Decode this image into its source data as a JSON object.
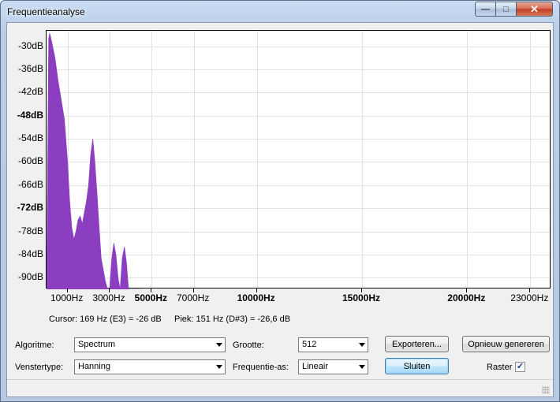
{
  "window": {
    "title": "Frequentieanalyse",
    "minimize_glyph": "—",
    "maximize_glyph": "□",
    "close_glyph": "✕"
  },
  "chart_data": {
    "type": "area",
    "color": "#8b3fc0",
    "title": "",
    "xlabel": "",
    "ylabel": "",
    "xlim": [
      0,
      24000
    ],
    "ylim": [
      -93,
      -26
    ],
    "grid": true,
    "y_ticks": [
      {
        "label": "-30dB",
        "value": -30,
        "bold": false
      },
      {
        "label": "-36dB",
        "value": -36,
        "bold": false
      },
      {
        "label": "-42dB",
        "value": -42,
        "bold": false
      },
      {
        "label": "-48dB",
        "value": -48,
        "bold": true
      },
      {
        "label": "-54dB",
        "value": -54,
        "bold": false
      },
      {
        "label": "-60dB",
        "value": -60,
        "bold": false
      },
      {
        "label": "-66dB",
        "value": -66,
        "bold": false
      },
      {
        "label": "-72dB",
        "value": -72,
        "bold": true
      },
      {
        "label": "-78dB",
        "value": -78,
        "bold": false
      },
      {
        "label": "-84dB",
        "value": -84,
        "bold": false
      },
      {
        "label": "-90dB",
        "value": -90,
        "bold": false
      }
    ],
    "x_ticks": [
      {
        "label": "1000Hz",
        "value": 1000,
        "bold": false
      },
      {
        "label": "3000Hz",
        "value": 3000,
        "bold": false
      },
      {
        "label": "5000Hz",
        "value": 5000,
        "bold": true
      },
      {
        "label": "7000Hz",
        "value": 7000,
        "bold": false
      },
      {
        "label": "10000Hz",
        "value": 10000,
        "bold": true
      },
      {
        "label": "15000Hz",
        "value": 15000,
        "bold": true
      },
      {
        "label": "20000Hz",
        "value": 20000,
        "bold": true
      },
      {
        "label": "23000Hz",
        "value": 23000,
        "bold": false
      }
    ],
    "x": [
      0,
      100,
      151,
      250,
      400,
      550,
      700,
      850,
      1000,
      1100,
      1200,
      1300,
      1400,
      1500,
      1600,
      1700,
      1800,
      1900,
      2000,
      2100,
      2200,
      2300,
      2400,
      2500,
      2600,
      2700,
      2800,
      2900,
      3000,
      3100,
      3200,
      3300,
      3400,
      3500,
      3600,
      3700,
      3800,
      3900,
      4000,
      4100,
      4200,
      4300,
      4400,
      4500
    ],
    "y": [
      -93,
      -28,
      -26.6,
      -29,
      -33,
      -39,
      -44,
      -49,
      -60,
      -70,
      -77,
      -80,
      -78,
      -75,
      -74,
      -76,
      -73,
      -70,
      -66,
      -58,
      -54,
      -60,
      -68,
      -77,
      -85,
      -88,
      -91,
      -93,
      -93,
      -85,
      -81,
      -84,
      -90,
      -93,
      -85,
      -82,
      -86,
      -93,
      -93,
      -93,
      -93,
      -93,
      -93,
      -93
    ]
  },
  "info": {
    "cursor": "Cursor: 169 Hz (E3) = -26 dB",
    "peak": "Piek: 151 Hz (D#3) = -26,6 dB"
  },
  "controls": {
    "algorithm_label": "Algoritme:",
    "algorithm_value": "Spectrum",
    "window_type_label": "Venstertype:",
    "window_type_value": "Hanning",
    "size_label": "Grootte:",
    "size_value": "512",
    "freq_axis_label": "Frequentie-as:",
    "freq_axis_value": "Lineair",
    "export_button": "Exporteren...",
    "regenerate_button": "Opnieuw genereren",
    "close_button": "Sluiten",
    "grid_label": "Raster",
    "grid_checked": true,
    "check_glyph": "✓"
  }
}
